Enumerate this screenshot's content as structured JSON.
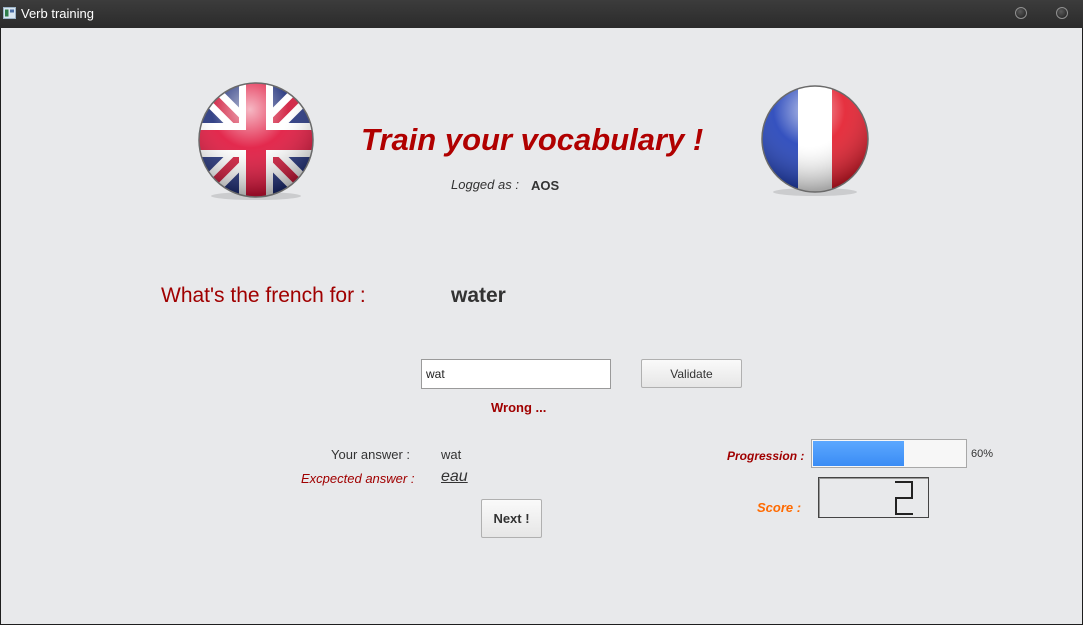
{
  "window": {
    "title": "Verb training"
  },
  "header": {
    "headline": "Train your vocabulary !",
    "logged_label": "Logged as :",
    "logged_user": "AOS",
    "left_flag": "uk-flag-icon",
    "right_flag": "france-flag-icon"
  },
  "quiz": {
    "question_label": "What's the french for :",
    "word": "water",
    "answer_value": "wat",
    "validate_label": "Validate",
    "status": "Wrong ...",
    "your_answer_label": "Your answer :",
    "your_answer_value": "wat",
    "expected_label": "Excpected answer :",
    "expected_value": "eau",
    "next_label": "Next !"
  },
  "stats": {
    "progression_label": "Progression :",
    "progression_value": 60,
    "progression_text": "60%",
    "score_label": "Score :",
    "score_value": "2"
  },
  "colors": {
    "accent_red": "#b00000",
    "score_orange": "#ff6a00",
    "progress_blue": "#3a8cf5"
  }
}
